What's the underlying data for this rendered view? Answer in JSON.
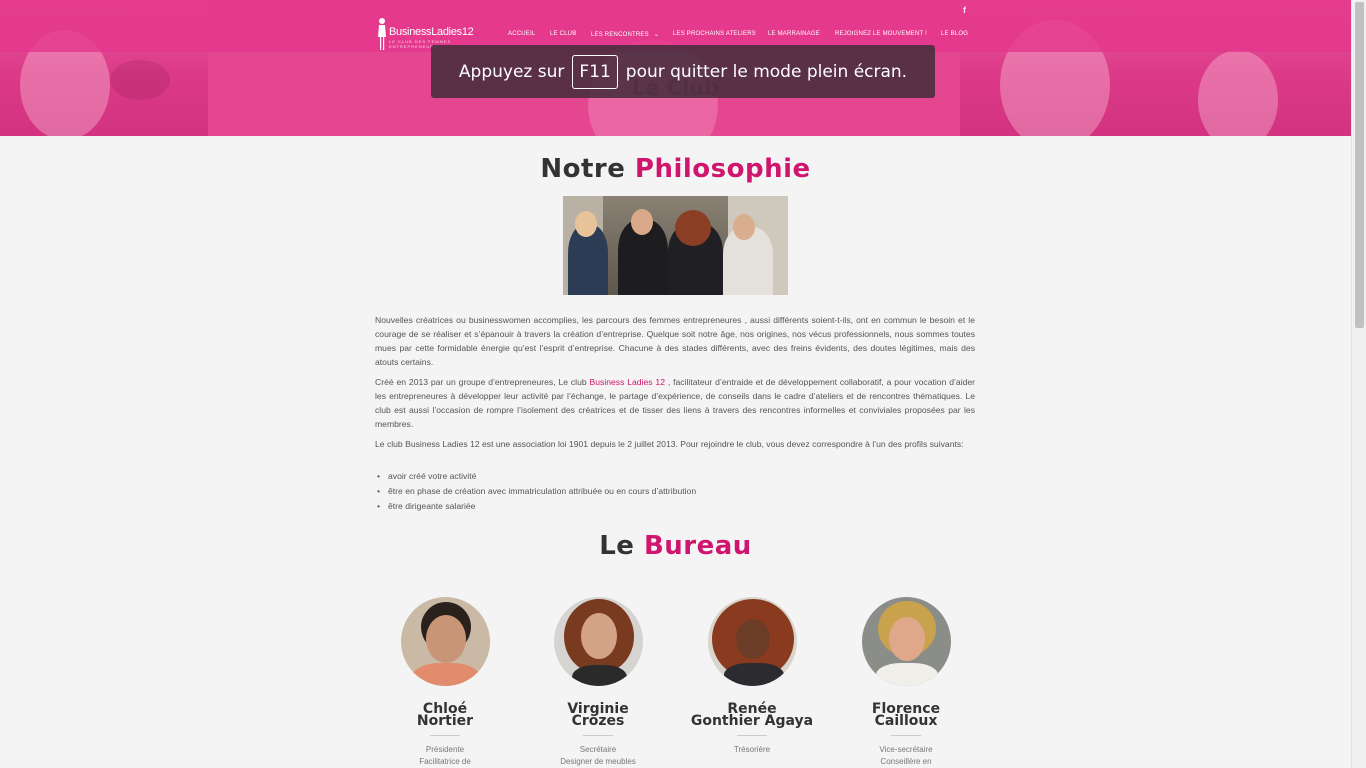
{
  "header": {
    "logo_text": "BusinessLadies12",
    "logo_subtitle": "LE CLUB DES FEMMES ENTREPRENEURES",
    "facebook_icon": "facebook-icon",
    "nav": [
      {
        "label": "ACCUEIL"
      },
      {
        "label": "LE CLUB"
      },
      {
        "label": "LES RENCONTRES",
        "chevron": "chevron-down-icon"
      },
      {
        "label": "LES PROCHAINS ATELIERS"
      },
      {
        "label": "LE MARRAINAGE"
      },
      {
        "label": "REJOIGNEZ LE MOUVEMENT !"
      },
      {
        "label": "LE BLOG"
      }
    ],
    "page_title": "Le Club",
    "brand_color": "#e23d8f"
  },
  "fullscreen_notice": {
    "before": "Appuyez sur",
    "key": "F11",
    "after": "pour quitter le mode plein écran."
  },
  "philosophy": {
    "title_plain": "Notre",
    "title_accent": "Philosophie",
    "paragraph1": "Nouvelles créatrices ou businesswomen accomplies, les parcours des femmes entrepreneures , aussi différents soient-t-ils, ont en commun le besoin et le courage de se réaliser et s’épanouir à travers la création d’entreprise. Quelque soit notre âge, nos origines, nos vécus professionnels, nous sommes toutes mues par cette formidable énergie qu’est l’esprit d’entreprise. Chacune à des stades différents, avec des freins évidents, des doutes légitimes, mais des atouts certains.",
    "paragraph2_before": "Créé en 2013 par un groupe d’entrepreneures, Le club",
    "paragraph2_link": "Business Ladies 12",
    "paragraph2_after": ", facilitateur d’entraide et de développement collaboratif, a pour vocation d’aider les entrepreneures à développer leur activité par l’échange, le partage d’expérience, de conseils dans le cadre d’ateliers et de rencontres thématiques. Le club est aussi l’occasion de rompre l’isolement des créatrices et de tisser des liens à travers des rencontres informelles et conviviales proposées par les membres.",
    "paragraph3": "Le club Business Ladies 12 est une association loi 1901 depuis le 2 juillet 2013. Pour rejoindre le club, vous devez correspondre à l’un des profils suivants:",
    "bullets": [
      "avoir créé votre activité",
      "être en phase de création avec immatriculation attribuée ou en cours d’attribution",
      "être dirigeante salariée"
    ]
  },
  "bureau": {
    "title_plain": "Le",
    "title_accent": "Bureau",
    "members": [
      {
        "first": "Chloé",
        "last": "Nortier",
        "role1": "Présidente",
        "role2": "Facilitatrice de"
      },
      {
        "first": "Virginie",
        "last": "Crozes",
        "role1": "Secrétaire",
        "role2": "Designer de meubles"
      },
      {
        "first": "Renée",
        "last": "Gonthier Agaya",
        "role1": "Trésorière",
        "role2": ""
      },
      {
        "first": "Florence",
        "last": "Cailloux",
        "role1": "Vice-secrétaire",
        "role2": "Conseillère en"
      }
    ]
  }
}
